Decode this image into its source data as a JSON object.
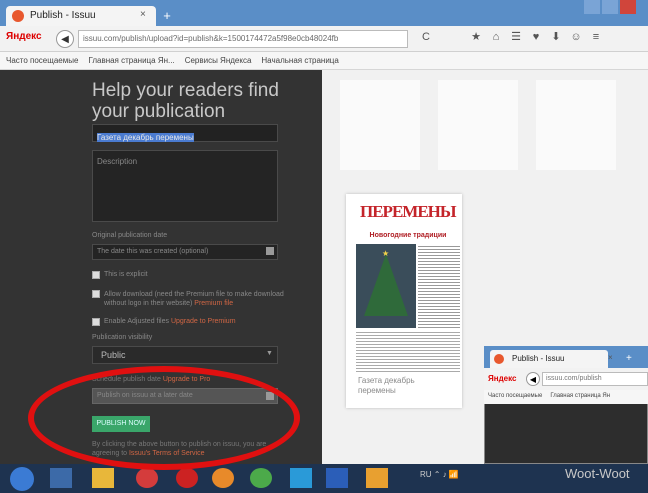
{
  "browser": {
    "tab_title": "Publish - Issuu",
    "tab_close": "×",
    "new_tab": "+",
    "yandex_logo": "Яндекс",
    "back": "◀",
    "url": "issuu.com/publish/upload?id=publish&k=1500174472a5f98e0cb48024fb",
    "reload": "C",
    "toolbar_icons": [
      "★",
      "⌂",
      "☰",
      "♥",
      "⬇",
      "☺",
      "≡"
    ],
    "bookmarks": [
      "Часто посещаемые",
      "Главная страница Ян...",
      "Сервисы Яндекса",
      "Начальная страница"
    ]
  },
  "form": {
    "title": "Help your readers find your publication",
    "title_value": "Газета декабрь перемены",
    "description_placeholder": "Description",
    "date_label": "Original publication date",
    "date_placeholder": "The date this was created (optional)",
    "checkbox_explicit": "This is explicit",
    "checkbox_download": "Allow download (need the Premium file to make download without logo in their website)",
    "checkbox_download_link": "Premium file",
    "checkbox_embed": "Enable Adjusted files",
    "checkbox_embed_link": "Upgrade to Premium",
    "visibility_label": "Publication visibility",
    "visibility_value": "Public",
    "schedule_label": "Schedule publish date",
    "schedule_link": "Upgrade to Pro",
    "schedule_placeholder": "Publish on issuu at a later date",
    "publish_button": "PUBLISH NOW",
    "terms_text": "By clicking the above button to publish on issuu, you are agreeing to",
    "terms_link": "Issuu's Terms of Service"
  },
  "thumbnail": {
    "masthead": "ПЕРЕМЕНЫ",
    "headline": "Новогодние традиции",
    "star": "★",
    "caption": "Газета декабрь перемены"
  },
  "inset": {
    "tab_title": "Publish - Issuu",
    "tab_close": "×",
    "new_tab": "+",
    "yandex_logo": "Яндекс",
    "back": "◀",
    "url": "issuu.com/publish",
    "bookmarks": [
      "Часто посещаемые",
      "Главная страница Ян"
    ],
    "heading": "Woot-Woot"
  },
  "taskbar": {
    "systray": "RU ⌃ ♪ 📶"
  },
  "colors": {
    "panel_bg": "#333333",
    "accent_link": "#d06644",
    "publish_green": "#3aa66a",
    "annotation_red": "#e01010",
    "taskbar": "#1e3350"
  }
}
